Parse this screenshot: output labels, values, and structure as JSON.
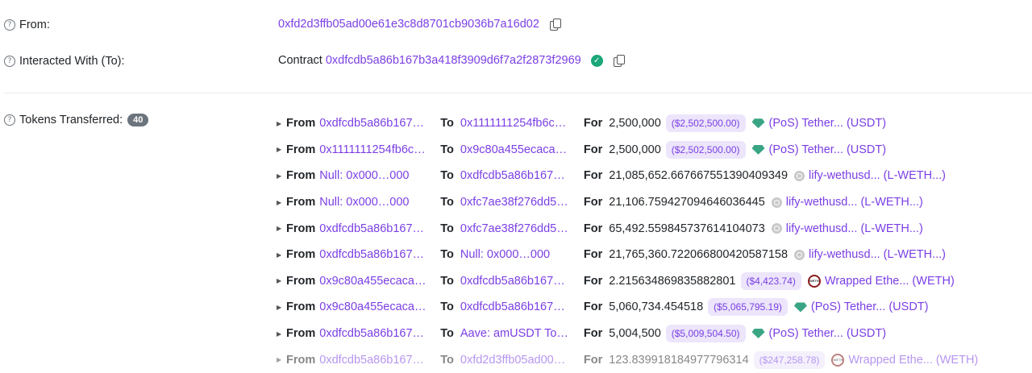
{
  "fields": {
    "from_label": "From:",
    "from_value": "0xfd2d3ffb05ad00e61e3c8d8701cb9036b7a16d02",
    "to_label": "Interacted With (To):",
    "to_prefix": "Contract",
    "to_value": "0xdfcdb5a86b167b3a418f3909d6f7a2f2873f2969",
    "tokens_label": "Tokens Transferred:",
    "tokens_count": "40"
  },
  "labels": {
    "from": "From",
    "to": "To",
    "for": "For"
  },
  "transfers": [
    {
      "from": "0xdfcdb5a86b167…",
      "to": "0x1111111254fb6c…",
      "amount": "2,500,000",
      "usd": "($2,502,500.00)",
      "icon": "tether-icon",
      "token": "(PoS) Tether... (USDT)"
    },
    {
      "from": "0x1111111254fb6c…",
      "to": "0x9c80a455ecaca…",
      "amount": "2,500,000",
      "usd": "($2,502,500.00)",
      "icon": "tether-icon",
      "token": "(PoS) Tether... (USDT)"
    },
    {
      "from": "Null: 0x000…000",
      "to": "0xdfcdb5a86b167…",
      "amount": "21,085,652.667667551390409349",
      "usd": "",
      "icon": "lify-icon",
      "token": "lify-wethusd... (L-WETH...)"
    },
    {
      "from": "Null: 0x000…000",
      "to": "0xfc7ae38f276dd5…",
      "amount": "21,106.759427094646036445",
      "usd": "",
      "icon": "lify-icon",
      "token": "lify-wethusd... (L-WETH...)"
    },
    {
      "from": "0xdfcdb5a86b167…",
      "to": "0xfc7ae38f276dd5…",
      "amount": "65,492.559845737614104073",
      "usd": "",
      "icon": "lify-icon",
      "token": "lify-wethusd... (L-WETH...)"
    },
    {
      "from": "0xdfcdb5a86b167…",
      "to": "Null: 0x000…000",
      "amount": "21,765,360.722066800420587158",
      "usd": "",
      "icon": "lify-icon",
      "token": "lify-wethusd... (L-WETH...)"
    },
    {
      "from": "0x9c80a455ecaca…",
      "to": "0xdfcdb5a86b167…",
      "amount": "2.215634869835882801",
      "usd": "($4,423.74)",
      "icon": "weth-icon",
      "token": "Wrapped Ethe... (WETH)"
    },
    {
      "from": "0x9c80a455ecaca…",
      "to": "0xdfcdb5a86b167…",
      "amount": "5,060,734.454518",
      "usd": "($5,065,795.19)",
      "icon": "tether-icon",
      "token": "(PoS) Tether... (USDT)"
    },
    {
      "from": "0xdfcdb5a86b167…",
      "to": "Aave: amUSDT To…",
      "amount": "5,004,500",
      "usd": "($5,009,504.50)",
      "icon": "tether-icon",
      "token": "(PoS) Tether... (USDT)"
    },
    {
      "from": "0xdfcdb5a86b167…",
      "to": "0xfd2d3ffb05ad00…",
      "amount": "123.839918184977796314",
      "usd": "($247,258.78)",
      "icon": "weth-icon",
      "token": "Wrapped Ethe... (WETH)"
    }
  ]
}
